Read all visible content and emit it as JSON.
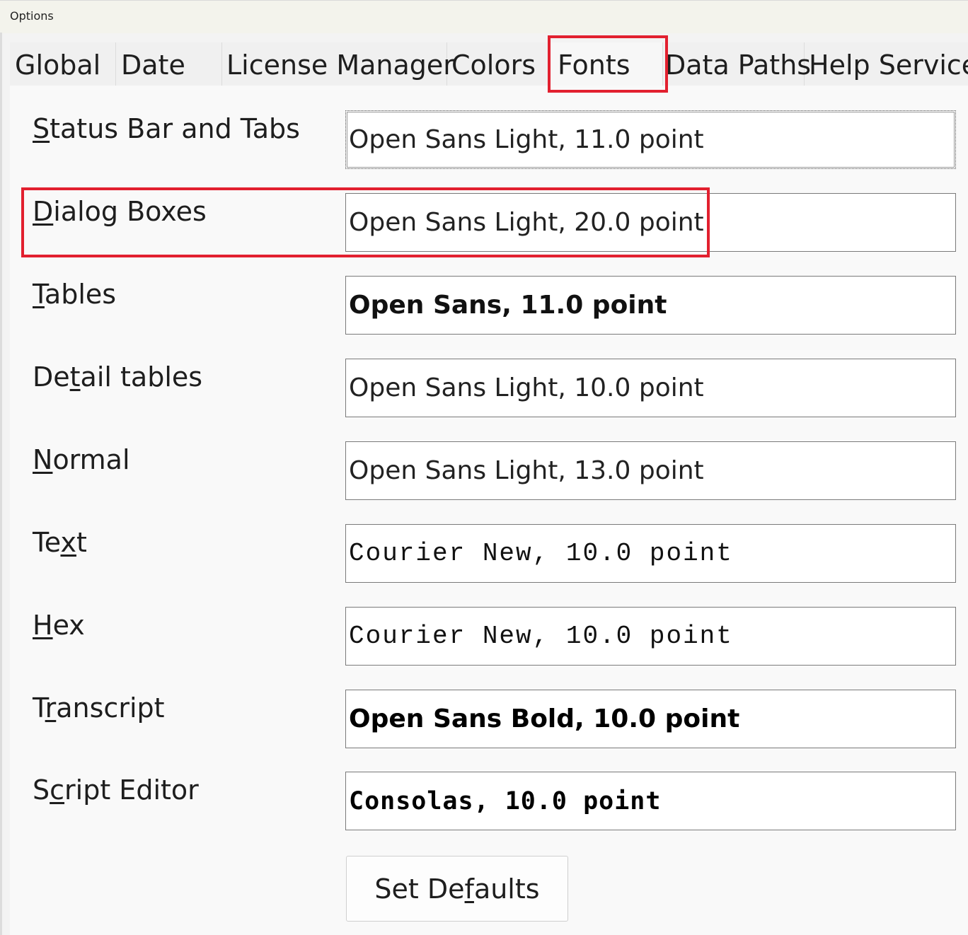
{
  "window": {
    "title": "Options"
  },
  "tabs": [
    {
      "label": "Global",
      "selected": false
    },
    {
      "label": "Date",
      "selected": false
    },
    {
      "label": "License Manager",
      "selected": false
    },
    {
      "label": "Colors",
      "selected": false
    },
    {
      "label": "Fonts",
      "selected": true
    },
    {
      "label": "Data Paths",
      "selected": false
    },
    {
      "label": "Help Service",
      "selected": false
    }
  ],
  "font_settings": [
    {
      "label_pre": "",
      "label_mn": "S",
      "label_post": "tatus Bar and Tabs",
      "value": "Open Sans Light, 11.0 point"
    },
    {
      "label_pre": "",
      "label_mn": "D",
      "label_post": "ialog Boxes",
      "value": "Open Sans Light, 20.0 point"
    },
    {
      "label_pre": "",
      "label_mn": "T",
      "label_post": "ables",
      "value": "Open Sans, 11.0 point"
    },
    {
      "label_pre": "De",
      "label_mn": "t",
      "label_post": "ail tables",
      "value": "Open Sans Light, 10.0 point"
    },
    {
      "label_pre": "",
      "label_mn": "N",
      "label_post": "ormal",
      "value": "Open Sans Light, 13.0 point"
    },
    {
      "label_pre": "Te",
      "label_mn": "x",
      "label_post": "t",
      "value": "Courier New, 10.0 point"
    },
    {
      "label_pre": "",
      "label_mn": "H",
      "label_post": "ex",
      "value": "Courier New, 10.0 point"
    },
    {
      "label_pre": "T",
      "label_mn": "r",
      "label_post": "anscript",
      "value": "Open Sans Bold, 10.0 point"
    },
    {
      "label_pre": "S",
      "label_mn": "c",
      "label_post": "ript Editor",
      "value": "Consolas, 10.0 point"
    }
  ],
  "buttons": {
    "set_defaults": {
      "pre": "Set De",
      "mn": "f",
      "post": "aults"
    }
  },
  "highlight_color": "#e2202f"
}
